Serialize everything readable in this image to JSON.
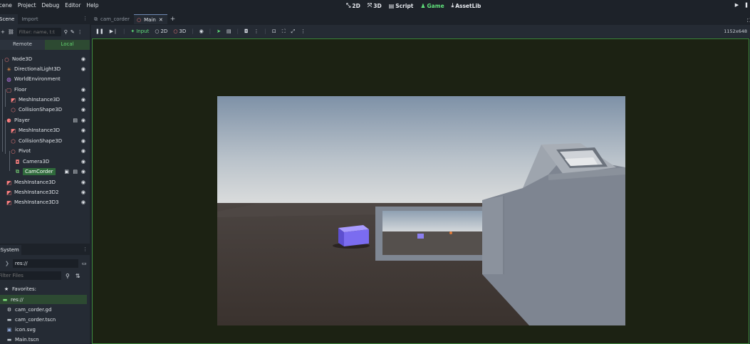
{
  "menubar": {
    "items": [
      "Scene",
      "Project",
      "Debug",
      "Editor",
      "Help"
    ],
    "modes": [
      {
        "label": "2D",
        "icon": "2d-icon",
        "active": false
      },
      {
        "label": "3D",
        "icon": "3d-icon",
        "active": false
      },
      {
        "label": "Script",
        "icon": "script-icon",
        "active": false
      },
      {
        "label": "Game",
        "icon": "game-icon",
        "active": true
      },
      {
        "label": "AssetLib",
        "icon": "assetlib-icon",
        "active": false
      }
    ]
  },
  "scene_dock": {
    "tabs": [
      "Scene",
      "Import"
    ],
    "filter_placeholder": "Filter: name, t:t",
    "remote_label": "Remote",
    "local_label": "Local",
    "nodes": [
      {
        "label": "Node3D",
        "icon": "node3d-icon"
      },
      {
        "label": "DirectionalLight3D",
        "icon": "light-icon"
      },
      {
        "label": "WorldEnvironment",
        "icon": "world-icon"
      },
      {
        "label": "Floor",
        "icon": "staticbody-icon"
      },
      {
        "label": "MeshInstance3D",
        "icon": "mesh-icon"
      },
      {
        "label": "CollisionShape3D",
        "icon": "collision-icon"
      },
      {
        "label": "Player",
        "icon": "body-icon"
      },
      {
        "label": "MeshInstance3D",
        "icon": "mesh-icon"
      },
      {
        "label": "CollisionShape3D",
        "icon": "collision-icon"
      },
      {
        "label": "Pivot",
        "icon": "node3d-icon"
      },
      {
        "label": "Camera3D",
        "icon": "camera-icon"
      },
      {
        "label": "CamCorder",
        "icon": "viewport-icon",
        "selected": true
      },
      {
        "label": "MeshInstance3D",
        "icon": "mesh-icon"
      },
      {
        "label": "MeshInstance3D2",
        "icon": "mesh-icon"
      },
      {
        "label": "MeshInstance3D3",
        "icon": "mesh-icon"
      }
    ]
  },
  "filesystem": {
    "tab": "FileSystem",
    "path": "res://",
    "filter_placeholder": "Filter Files",
    "favorites_label": "Favorites:",
    "items": [
      {
        "label": "res://",
        "icon": "folder-icon",
        "selected": true
      },
      {
        "label": "cam_corder.gd",
        "icon": "gear-icon"
      },
      {
        "label": "cam_corder.tscn",
        "icon": "scene-file-icon"
      },
      {
        "label": "icon.svg",
        "icon": "image-file-icon"
      },
      {
        "label": "Main.tscn",
        "icon": "scene-file-icon"
      }
    ]
  },
  "editor_tabs": [
    {
      "label": "cam_corder",
      "active": false
    },
    {
      "label": "Main",
      "active": true
    }
  ],
  "game_toolbar": {
    "input_label": "Input",
    "mode_2d_label": "2D",
    "mode_3d_label": "3D",
    "resolution": "1152x648"
  },
  "colors": {
    "accent_green": "#5fe07a",
    "selection": "#2f6a3b",
    "node_red": "#fc7f7f",
    "viewport_border": "#3e8a3e"
  }
}
